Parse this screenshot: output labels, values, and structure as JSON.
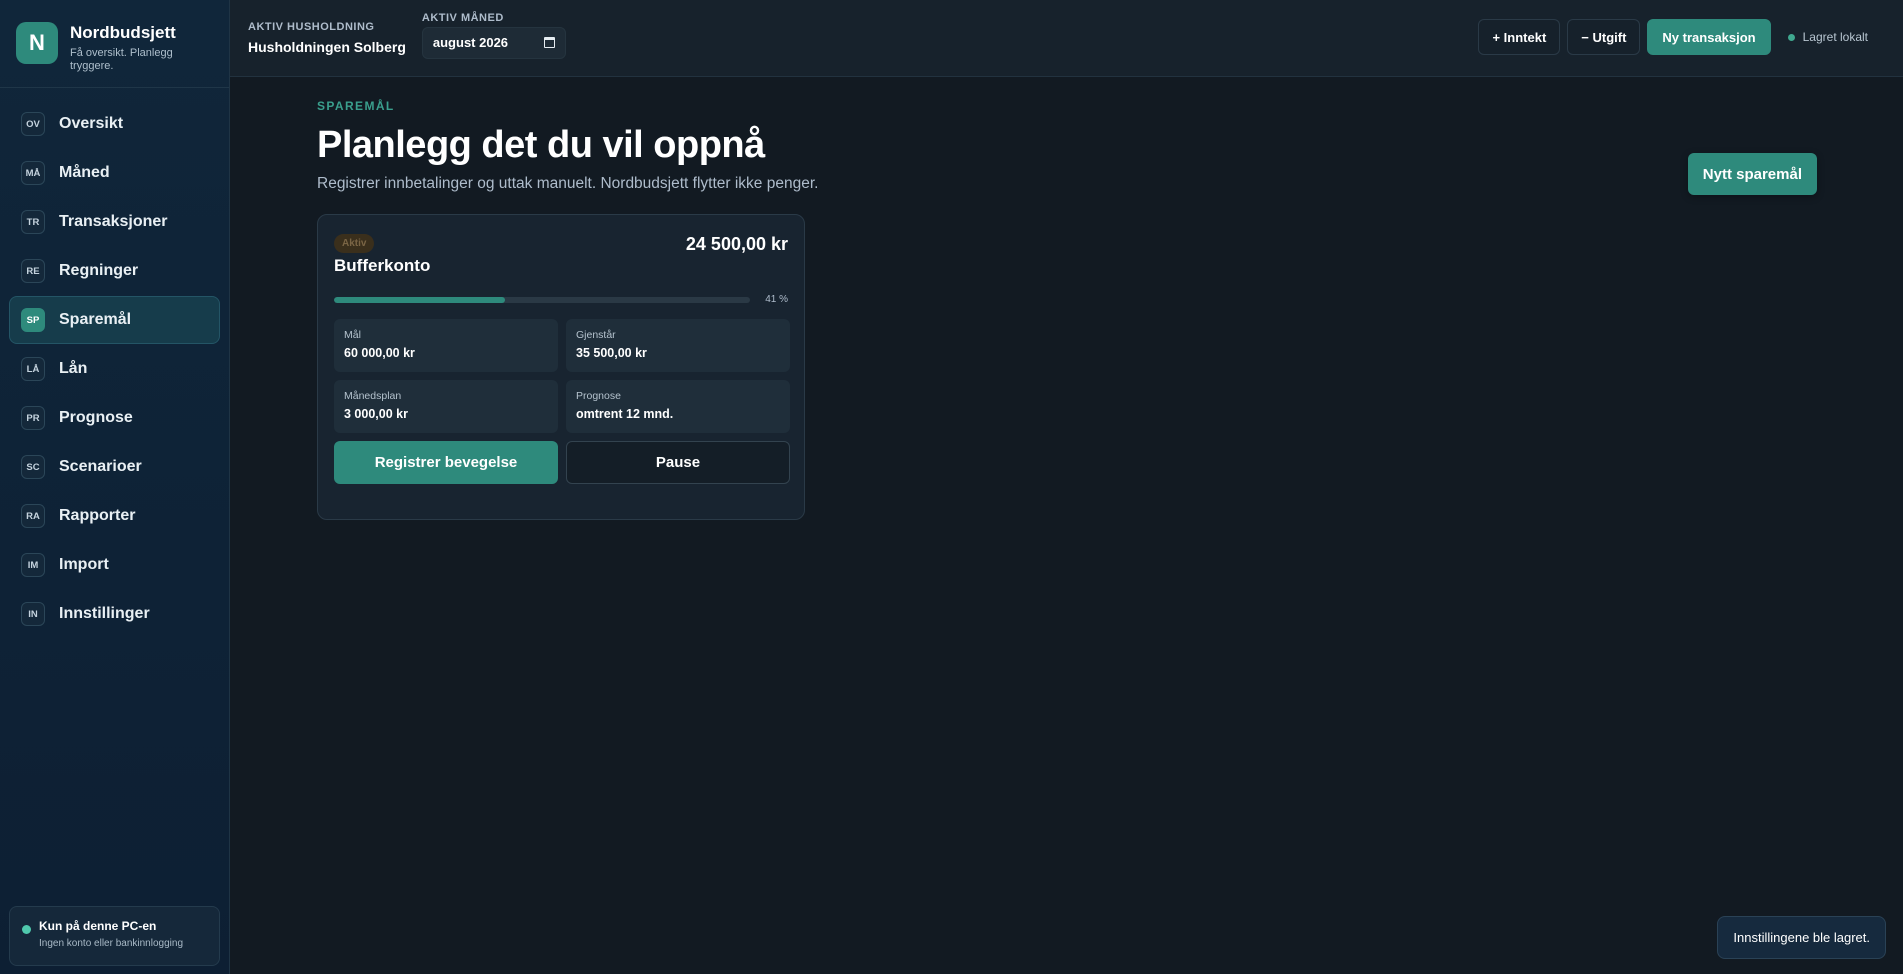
{
  "brand": {
    "logo_letter": "N",
    "title": "Nordbudsjett",
    "subtitle": "Få oversikt. Planlegg tryggere."
  },
  "nav": {
    "items": [
      {
        "badge": "OV",
        "label": "Oversikt"
      },
      {
        "badge": "MÅ",
        "label": "Måned"
      },
      {
        "badge": "TR",
        "label": "Transaksjoner"
      },
      {
        "badge": "RE",
        "label": "Regninger"
      },
      {
        "badge": "SP",
        "label": "Sparemål"
      },
      {
        "badge": "LÅ",
        "label": "Lån"
      },
      {
        "badge": "PR",
        "label": "Prognose"
      },
      {
        "badge": "SC",
        "label": "Scenarioer"
      },
      {
        "badge": "RA",
        "label": "Rapporter"
      },
      {
        "badge": "IM",
        "label": "Import"
      },
      {
        "badge": "IN",
        "label": "Innstillinger"
      }
    ],
    "active": "Sparemål"
  },
  "local": {
    "title": "Kun på denne PC-en",
    "subtitle": "Ingen konto eller bankinnlogging"
  },
  "topbar": {
    "household_label": "AKTIV HUSHOLDNING",
    "household_value": "Husholdningen Solberg",
    "month_label": "AKTIV MÅNED",
    "month_value": "august 2026",
    "income_button": "+ Inntekt",
    "expense_button": "− Utgift",
    "new_transaction_button": "Ny transaksjon",
    "saved_status": "Lagret lokalt"
  },
  "page": {
    "eyebrow": "SPAREMÅL",
    "title": "Planlegg det du vil oppnå",
    "subtitle": "Registrer innbetalinger og uttak manuelt. Nordbudsjett flytter ikke penger.",
    "new_goal_button": "Nytt sparemål"
  },
  "goal_card": {
    "status": "Aktiv",
    "amount": "24 500,00 kr",
    "name": "Bufferkonto",
    "progress_percent": 41,
    "progress_label": "41 %",
    "stats": {
      "goal_label": "Mål",
      "goal_value": "60 000,00 kr",
      "remaining_label": "Gjenstår",
      "remaining_value": "35 500,00 kr",
      "monthly_label": "Månedsplan",
      "monthly_value": "3 000,00 kr",
      "forecast_label": "Prognose",
      "forecast_value": "omtrent 12 mnd."
    },
    "register_button": "Registrer bevegelse",
    "pause_button": "Pause"
  },
  "toast": {
    "message": "Innstillingene ble lagret."
  },
  "colors": {
    "accent": "#2e8a7c",
    "background": "#121a22",
    "sidebar": "#10263a"
  }
}
